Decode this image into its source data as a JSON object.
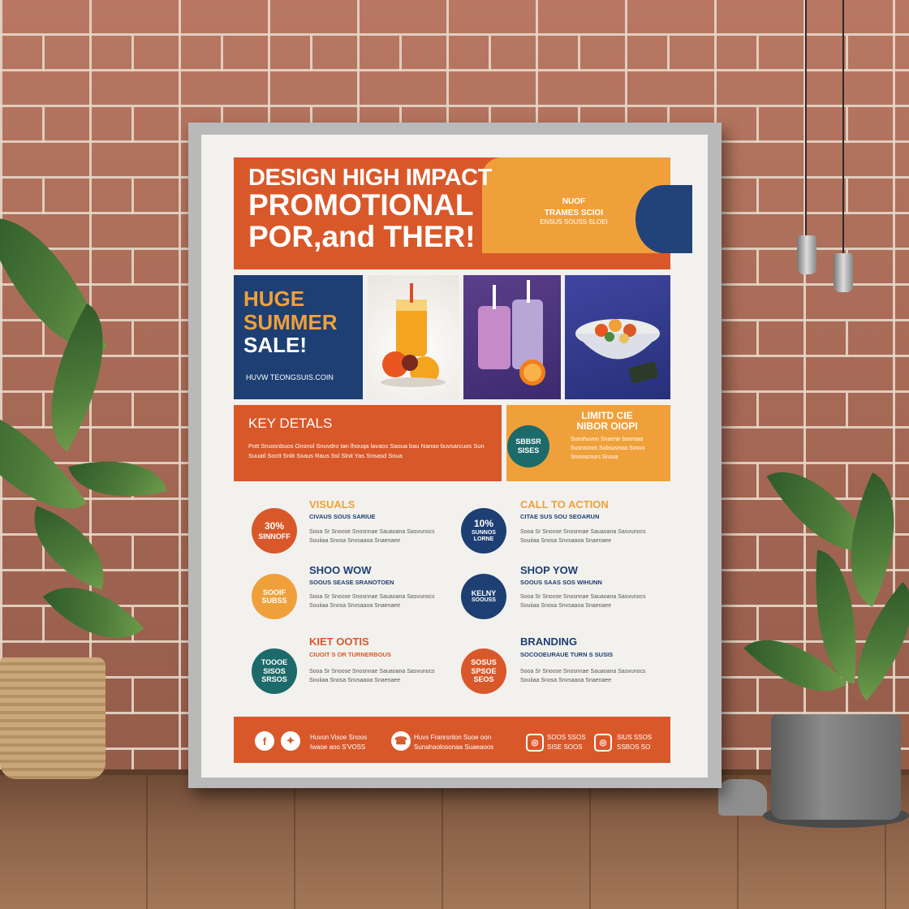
{
  "poster": {
    "headline": [
      "DESIGN HIGH IMPACT",
      "PROMOTIONAL",
      "POR,and THER!"
    ],
    "header_small": [
      "NUOF",
      "TRAMES SCIOI",
      "ENSUS SOUSS SLOEI"
    ],
    "sale": [
      "HUGE",
      "SUMMER",
      "SALE!"
    ],
    "site": "HUVW TEONGSUIS.COIN",
    "key_title": "KEY DETALS",
    "key_text": "Pott Sruosnbuos Onsnol Snuvdro tan lhouqa lavaos Saoua bau Nanao buvsarcuos Sun Suuatl Soctt Snlit Sxaus Raus Ssl Slnit Yas Snsasd Soua",
    "limited_title": [
      "LIMITD CIE",
      "NIBOR OIOPI"
    ],
    "limited_circle": [
      "SBBSR",
      "SISES"
    ],
    "limited_text": "Sunshuvnn Snaerar bosroaa Susrocnos Subsuvnoa Sosvo Snonscnurs Snsva",
    "features": [
      {
        "title": "VISUALS",
        "sub": "CIVAUS SOUS SARIUE",
        "circle": [
          "30%",
          "SINNOFF"
        ],
        "text": "Sooa Sr Snoose Snosnnae Sauaoana Sasvunocs Souiiaa Snosa Snvsaaoa Snaenaee"
      },
      {
        "title": "CALL TO ACTION",
        "sub": "CITAE SUS SOU SEOARUN",
        "circle": [
          "10%",
          "SUNNOS LORNE"
        ],
        "text": "Sooa Sr Snoose Snosnnae Sauaoana Sasvunocs Souiiaa Snosa Snvsaaoa Snaenaee"
      },
      {
        "title": "SHOO WOW",
        "sub": "SOOUS SEASE SRANOTOEN",
        "circle": [
          "SOOIF",
          "SUBSS"
        ],
        "text": "Sooa Sr Snoose Snosnnae Sauaoana Sasvunocs Souiiaa Snosa Snvsaaoa Snaenaee"
      },
      {
        "title": "SHOP YOW",
        "sub": "SOOUS SAAS SOS WIHUNN",
        "circle": [
          "KELNY",
          "SOOUSS"
        ],
        "text": "Sooa Sr Snoose Snosnnae Sauaoana Sasvunocs Souiiaa Snosa Snvsaaoa Snaenaee"
      },
      {
        "title": "KIET OOTIS",
        "sub": "CIUOIT S OR TURNERBOUS",
        "circle": [
          "TOOOE",
          "SISOS",
          "SRSOS"
        ],
        "text": "Sooa Sr Snoose Snosnnae Sauaoana Sasvunocs Souiiaa Snosa Snvsaaoa Snaenaee"
      },
      {
        "title": "BRANDING",
        "sub": "SOCOOEURAUE TURN S SUSIS",
        "circle": [
          "SOSUS",
          "SPSOE",
          "SEOS"
        ],
        "text": "Sooa Sr Snoose Snosnnae Sauaoana Sasvunocs Souiiaa Snosa Snvsaaoa Snaenaee"
      }
    ],
    "footer": {
      "social_text": [
        "Huvon Visoe Snoos",
        "Iwaoe aoo S'VOSS"
      ],
      "phone_text": [
        "Huvs Franrsnlon Suoe oon",
        "Sunahaolosonaa Suaeaoos"
      ],
      "ig1": [
        "SOOS SSOS",
        "SISE SOOS"
      ],
      "ig2": [
        "SIUS SSOS",
        "SSBOS SO"
      ]
    }
  },
  "colors": {
    "orange": "#d9582a",
    "gold": "#f0a03a",
    "navy": "#1d3f73",
    "teal": "#1d6a6a"
  }
}
